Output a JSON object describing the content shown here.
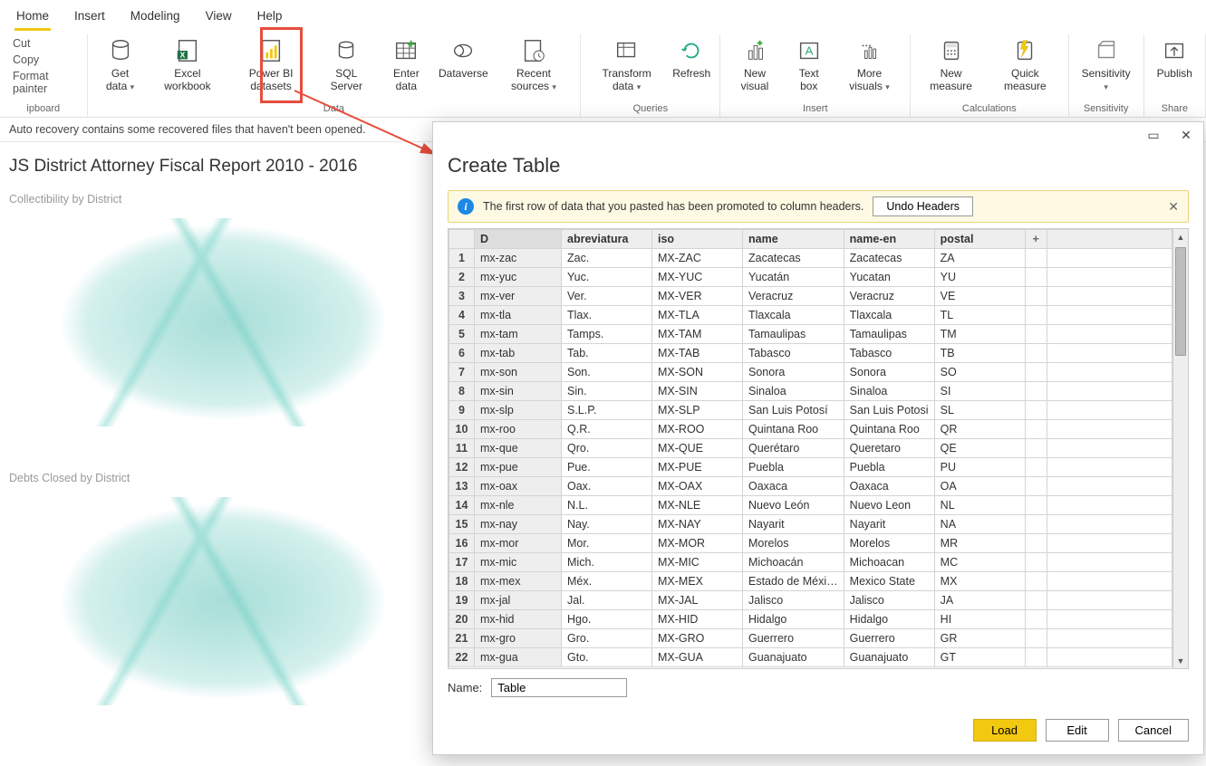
{
  "tabs": [
    "Home",
    "Insert",
    "Modeling",
    "View",
    "Help"
  ],
  "activeTab": 0,
  "clipboard": {
    "cut": "Cut",
    "copy": "Copy",
    "fp": "Format painter",
    "label": "ipboard"
  },
  "ribbon": {
    "data": {
      "label": "Data",
      "get": "Get data",
      "excel": "Excel workbook",
      "pbi": "Power BI datasets",
      "sql": "SQL Server",
      "enter": "Enter data",
      "dv": "Dataverse",
      "recent": "Recent sources"
    },
    "queries": {
      "label": "Queries",
      "transform": "Transform data",
      "refresh": "Refresh"
    },
    "insert": {
      "label": "Insert",
      "newvis": "New visual",
      "textbox": "Text box",
      "morevis": "More visuals"
    },
    "calc": {
      "label": "Calculations",
      "newmeasure": "New measure",
      "quick": "Quick measure"
    },
    "sens": {
      "label": "Sensitivity",
      "btn": "Sensitivity"
    },
    "share": {
      "label": "Share",
      "publish": "Publish"
    }
  },
  "recoveryMsg": "Auto recovery contains some recovered files that haven't been opened.",
  "report": {
    "title": "JS District Attorney Fiscal Report 2010 - 2016",
    "viz1": "Collectibility by District",
    "viz2": "Debts Closed by District"
  },
  "dialog": {
    "title": "Create Table",
    "infoMsg": "The first row of data that you pasted has been promoted to column headers.",
    "undo": "Undo Headers",
    "headers": [
      "D",
      "abreviatura",
      "iso",
      "name",
      "name-en",
      "postal"
    ],
    "rows": [
      [
        "mx-zac",
        "Zac.",
        "MX-ZAC",
        "Zacatecas",
        "Zacatecas",
        "ZA"
      ],
      [
        "mx-yuc",
        "Yuc.",
        "MX-YUC",
        "Yucatán",
        "Yucatan",
        "YU"
      ],
      [
        "mx-ver",
        "Ver.",
        "MX-VER",
        "Veracruz",
        "Veracruz",
        "VE"
      ],
      [
        "mx-tla",
        "Tlax.",
        "MX-TLA",
        "Tlaxcala",
        "Tlaxcala",
        "TL"
      ],
      [
        "mx-tam",
        "Tamps.",
        "MX-TAM",
        "Tamaulipas",
        "Tamaulipas",
        "TM"
      ],
      [
        "mx-tab",
        "Tab.",
        "MX-TAB",
        "Tabasco",
        "Tabasco",
        "TB"
      ],
      [
        "mx-son",
        "Son.",
        "MX-SON",
        "Sonora",
        "Sonora",
        "SO"
      ],
      [
        "mx-sin",
        "Sin.",
        "MX-SIN",
        "Sinaloa",
        "Sinaloa",
        "SI"
      ],
      [
        "mx-slp",
        "S.L.P.",
        "MX-SLP",
        "San Luis Potosí",
        "San Luis Potosi",
        "SL"
      ],
      [
        "mx-roo",
        "Q.R.",
        "MX-ROO",
        "Quintana Roo",
        "Quintana Roo",
        "QR"
      ],
      [
        "mx-que",
        "Qro.",
        "MX-QUE",
        "Querétaro",
        "Queretaro",
        "QE"
      ],
      [
        "mx-pue",
        "Pue.",
        "MX-PUE",
        "Puebla",
        "Puebla",
        "PU"
      ],
      [
        "mx-oax",
        "Oax.",
        "MX-OAX",
        "Oaxaca",
        "Oaxaca",
        "OA"
      ],
      [
        "mx-nle",
        "N.L.",
        "MX-NLE",
        "Nuevo León",
        "Nuevo Leon",
        "NL"
      ],
      [
        "mx-nay",
        "Nay.",
        "MX-NAY",
        "Nayarit",
        "Nayarit",
        "NA"
      ],
      [
        "mx-mor",
        "Mor.",
        "MX-MOR",
        "Morelos",
        "Morelos",
        "MR"
      ],
      [
        "mx-mic",
        "Mich.",
        "MX-MIC",
        "Michoacán",
        "Michoacan",
        "MC"
      ],
      [
        "mx-mex",
        "Méx.",
        "MX-MEX",
        "Estado de Méxi…",
        "Mexico State",
        "MX"
      ],
      [
        "mx-jal",
        "Jal.",
        "MX-JAL",
        "Jalisco",
        "Jalisco",
        "JA"
      ],
      [
        "mx-hid",
        "Hgo.",
        "MX-HID",
        "Hidalgo",
        "Hidalgo",
        "HI"
      ],
      [
        "mx-gro",
        "Gro.",
        "MX-GRO",
        "Guerrero",
        "Guerrero",
        "GR"
      ],
      [
        "mx-gua",
        "Gto.",
        "MX-GUA",
        "Guanajuato",
        "Guanajuato",
        "GT"
      ]
    ],
    "nameLabel": "Name:",
    "nameValue": "Table",
    "load": "Load",
    "edit": "Edit",
    "cancel": "Cancel"
  }
}
